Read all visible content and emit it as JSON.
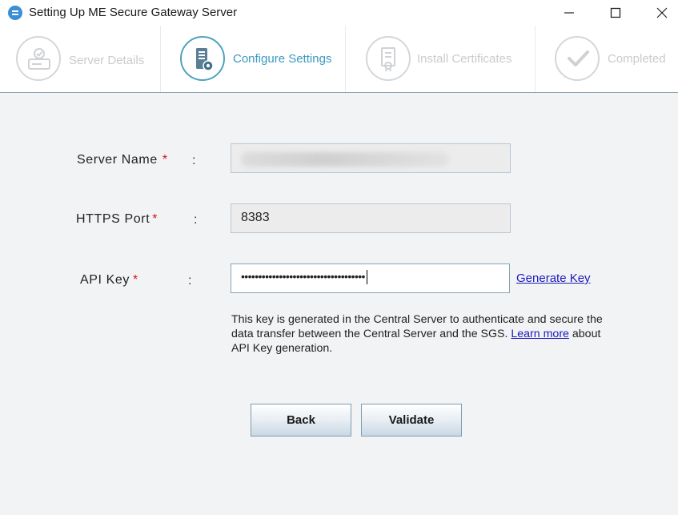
{
  "window": {
    "title": "Setting Up ME Secure Gateway Server",
    "controls": [
      "minimize-icon",
      "maximize-icon",
      "close-icon"
    ]
  },
  "steps": [
    {
      "label": "Server Details",
      "icon": "server-check-icon",
      "state": "inactive"
    },
    {
      "label": "Configure Settings",
      "icon": "server-gear-icon",
      "state": "active"
    },
    {
      "label": "Install Certificates",
      "icon": "certificate-icon",
      "state": "inactive"
    },
    {
      "label": "Completed",
      "icon": "checkmark-icon",
      "state": "inactive"
    }
  ],
  "form": {
    "server_name": {
      "label": "Server Name",
      "required": "*",
      "colon": ":",
      "value": "",
      "blurred": true
    },
    "https_port": {
      "label": "HTTPS Port",
      "required": "*",
      "colon": ":",
      "value": "8383"
    },
    "api_key": {
      "label": "API Key",
      "required": "*",
      "colon": ":",
      "value": "••••••••••••••••••••••••••••••••••••",
      "generate_label": "Generate Key"
    }
  },
  "help": {
    "text_before": "This key is generated in the Central Server to authenticate and secure the data transfer between the Central Server and the SGS.",
    "link": "Learn more",
    "text_after": "about API Key generation."
  },
  "buttons": {
    "back": "Back",
    "validate": "Validate"
  },
  "colors": {
    "active_step": "#3a98c0",
    "required": "#dd1111",
    "link": "#1a1ab8"
  }
}
